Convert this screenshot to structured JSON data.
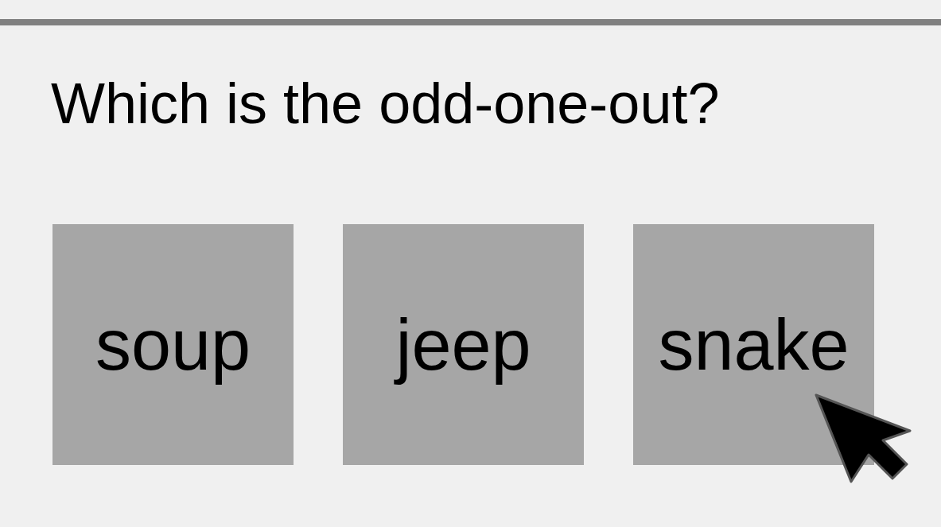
{
  "question": "Which is the odd-one-out?",
  "options": [
    {
      "label": "soup"
    },
    {
      "label": "jeep"
    },
    {
      "label": "snake"
    }
  ]
}
